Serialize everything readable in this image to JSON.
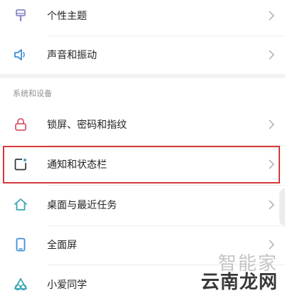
{
  "settings": {
    "items_top": [
      {
        "label": "个性主题",
        "icon": "brush-icon"
      },
      {
        "label": "声音和振动",
        "icon": "speaker-icon"
      }
    ],
    "section_header": "系统和设备",
    "items_system": [
      {
        "label": "锁屏、密码和指纹",
        "icon": "lock-icon"
      },
      {
        "label": "通知和状态栏",
        "icon": "notification-icon"
      },
      {
        "label": "桌面与最近任务",
        "icon": "home-icon"
      },
      {
        "label": "全面屏",
        "icon": "phone-icon"
      },
      {
        "label": "小爱同学",
        "icon": "assistant-icon"
      }
    ]
  },
  "watermark": {
    "top": "智能家",
    "bottom": "云南龙网"
  },
  "colors": {
    "icon_purple": "#8b86c9",
    "icon_blue": "#3f8fd9",
    "icon_red": "#d7576a",
    "icon_teal": "#3ba7b6",
    "highlight": "#d63a3a"
  }
}
